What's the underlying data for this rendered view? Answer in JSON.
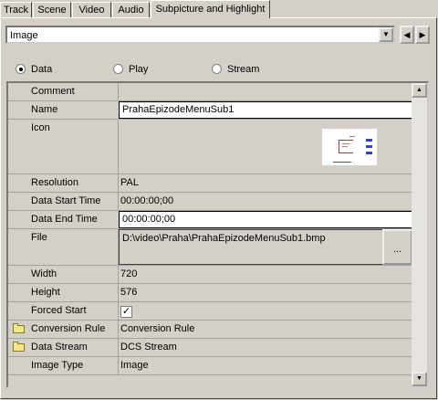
{
  "tabs": [
    "Track",
    "Scene",
    "Video",
    "Audio",
    "Subpicture and Highlight"
  ],
  "combo": {
    "value": "Image"
  },
  "nav": {
    "prev": "◀",
    "next": "▶"
  },
  "radios": {
    "data": "Data",
    "play": "Play",
    "stream": "Stream",
    "selected": "Data"
  },
  "properties": [
    {
      "name": "Comment",
      "value": ""
    },
    {
      "name": "Name",
      "value": "PrahaEpizodeMenuSub1"
    },
    {
      "name": "Icon",
      "value": ""
    },
    {
      "name": "Resolution",
      "value": "PAL"
    },
    {
      "name": "Data Start Time",
      "value": "00:00:00;00"
    },
    {
      "name": "Data End Time",
      "value": "00:00:00;00"
    },
    {
      "name": "File",
      "value": "D:\\video\\Praha\\PrahaEpizodeMenuSub1.bmp",
      "button": "..."
    },
    {
      "name": "Width",
      "value": "720"
    },
    {
      "name": "Height",
      "value": "576"
    },
    {
      "name": "Forced Start",
      "value": "✓"
    },
    {
      "name": "Conversion Rule",
      "value": "Conversion Rule"
    },
    {
      "name": "Data Stream",
      "value": "DCS Stream"
    },
    {
      "name": "Image Type",
      "value": "Image"
    }
  ],
  "icons": {
    "folder": "folder-icon",
    "thumbnail": "image-thumbnail"
  },
  "colors": {
    "face": "#d4d0c8",
    "editBg": "#ffffff",
    "folder": "#f4e48a"
  }
}
